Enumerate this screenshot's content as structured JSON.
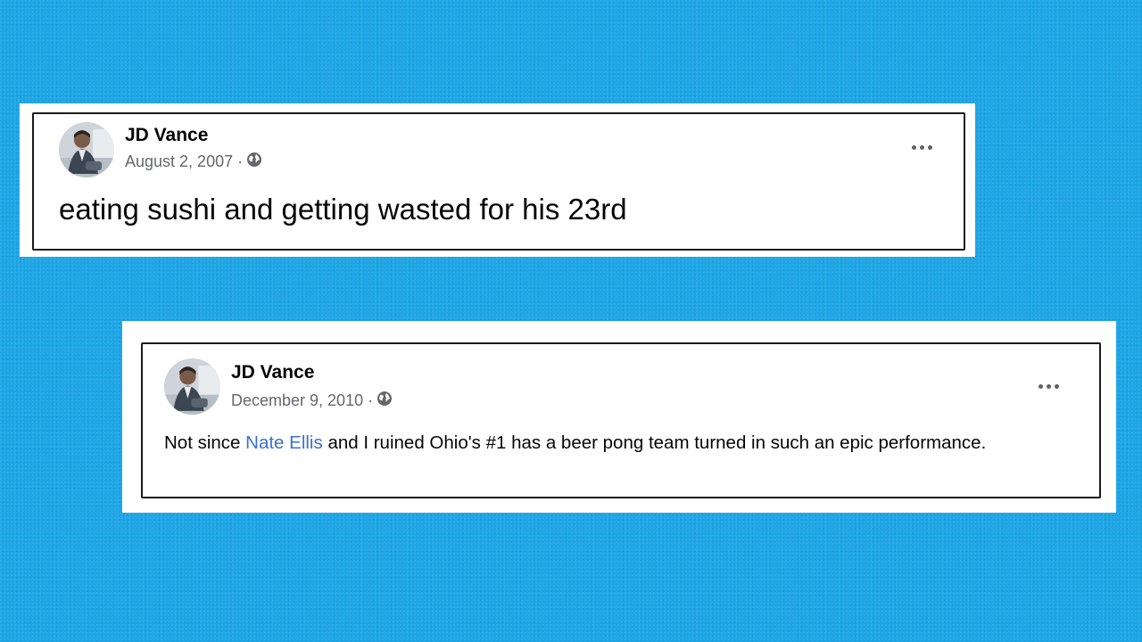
{
  "posts": [
    {
      "author": "JD Vance",
      "date": "August 2, 2007",
      "separator": "·",
      "privacy_icon": "globe-icon",
      "text": "eating sushi and getting wasted for his 23rd",
      "menu_icon": "more-options-icon"
    },
    {
      "author": "JD Vance",
      "date": "December 9, 2010",
      "separator": "·",
      "privacy_icon": "globe-icon",
      "text_before": "Not since ",
      "mention": "Nate Ellis",
      "text_after": " and I ruined Ohio's #1 has a beer pong team turned in such an epic performance.",
      "menu_icon": "more-options-icon"
    }
  ],
  "colors": {
    "background": "#1ea6e6",
    "card": "#ffffff",
    "border": "#1a1a1a",
    "meta": "#65676b",
    "mention": "#3b6fd1"
  }
}
